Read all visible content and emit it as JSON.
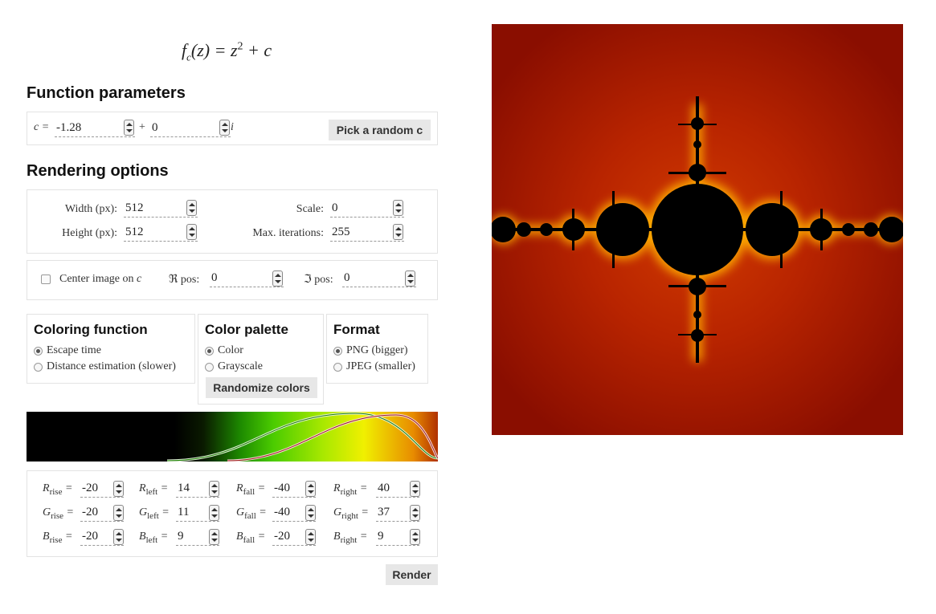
{
  "formula": {
    "f": "f",
    "sub": "c",
    "arg": "(z) = z",
    "sup": "2",
    "tail": " + c"
  },
  "function_params": {
    "title": "Function parameters",
    "c_label": "c =",
    "c_real": "-1.28",
    "plus": "+",
    "c_imag": "0",
    "i_label": "i",
    "random_button": "Pick a random c"
  },
  "rendering": {
    "title": "Rendering options",
    "width_label": "Width (px):",
    "width_value": "512",
    "height_label": "Height (px):",
    "height_value": "512",
    "scale_label": "Scale:",
    "scale_value": "0",
    "maxiter_label": "Max. iterations:",
    "maxiter_value": "255",
    "center_label": "Center image on",
    "center_var": "c",
    "re_label": "ℜ pos:",
    "re_value": "0",
    "im_label": "ℑ pos:",
    "im_value": "0"
  },
  "coloring": {
    "title": "Coloring function",
    "options": [
      "Escape time",
      "Distance estimation (slower)"
    ],
    "selected": "Escape time"
  },
  "palette": {
    "title": "Color palette",
    "options": [
      "Color",
      "Grayscale"
    ],
    "selected": "Color",
    "randomize_button": "Randomize colors"
  },
  "format": {
    "title": "Format",
    "options": [
      "PNG (bigger)",
      "JPEG (smaller)"
    ],
    "selected": "PNG (bigger)"
  },
  "params": {
    "rows": [
      {
        "ch": "R",
        "rise": "-20",
        "left": "14",
        "fall": "-40",
        "right": "40"
      },
      {
        "ch": "G",
        "rise": "-20",
        "left": "11",
        "fall": "-40",
        "right": "37"
      },
      {
        "ch": "B",
        "rise": "-20",
        "left": "9",
        "fall": "-20",
        "right": "9"
      }
    ],
    "subs": {
      "rise": "rise",
      "left": "left",
      "fall": "fall",
      "right": "right"
    },
    "eq": "="
  },
  "render_button": "Render",
  "colors": {
    "fractal_bg": "#a01400",
    "fractal_body": "#000000",
    "glow": "#ffd000",
    "button_bg": "#e7e7e7"
  }
}
